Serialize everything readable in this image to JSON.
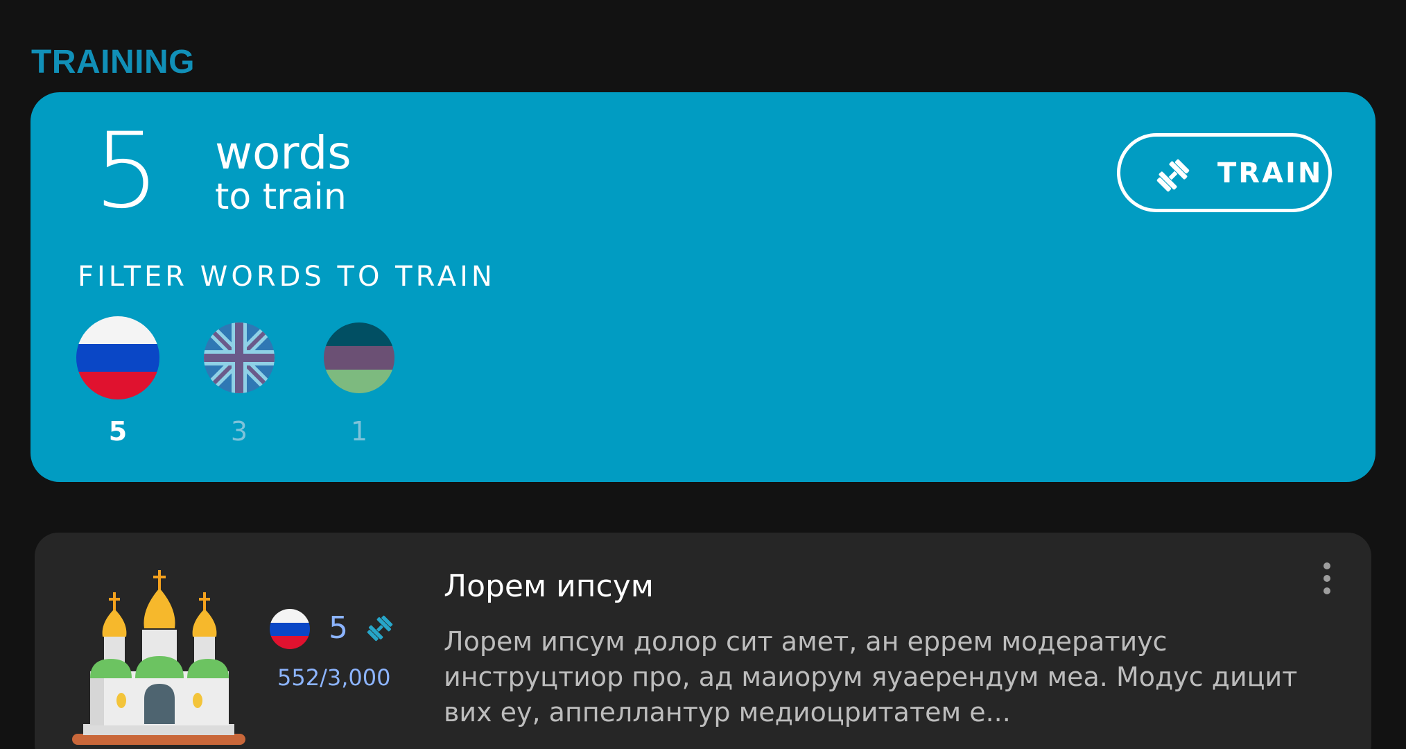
{
  "section": {
    "title": "TRAINING"
  },
  "training": {
    "count": "5",
    "words_label": "words",
    "to_train_label": "to train",
    "train_button_label": "TRAIN",
    "filter_title": "FILTER WORDS TO TRAIN",
    "filters": [
      {
        "language": "russian-flag",
        "count": "5",
        "selected": true
      },
      {
        "language": "uk-flag",
        "count": "3",
        "selected": false
      },
      {
        "language": "tricolor-flag",
        "count": "1",
        "selected": false
      }
    ]
  },
  "course": {
    "title": "Лорем ипсум",
    "flag": "russian-flag",
    "count": "5",
    "progress": "552/3,000",
    "description": "Лорем ипсум долор сит амет, ан еррем модератиус инструцтиор про, ад маиорум яуаерендум меа. Модус дицит вих еу, аппеллантур медиоцритатем е..."
  },
  "colors": {
    "accent": "#019cc2",
    "section_title": "#1190b8",
    "background": "#121212",
    "card": "#262626",
    "progress": "#8cb4ff"
  }
}
